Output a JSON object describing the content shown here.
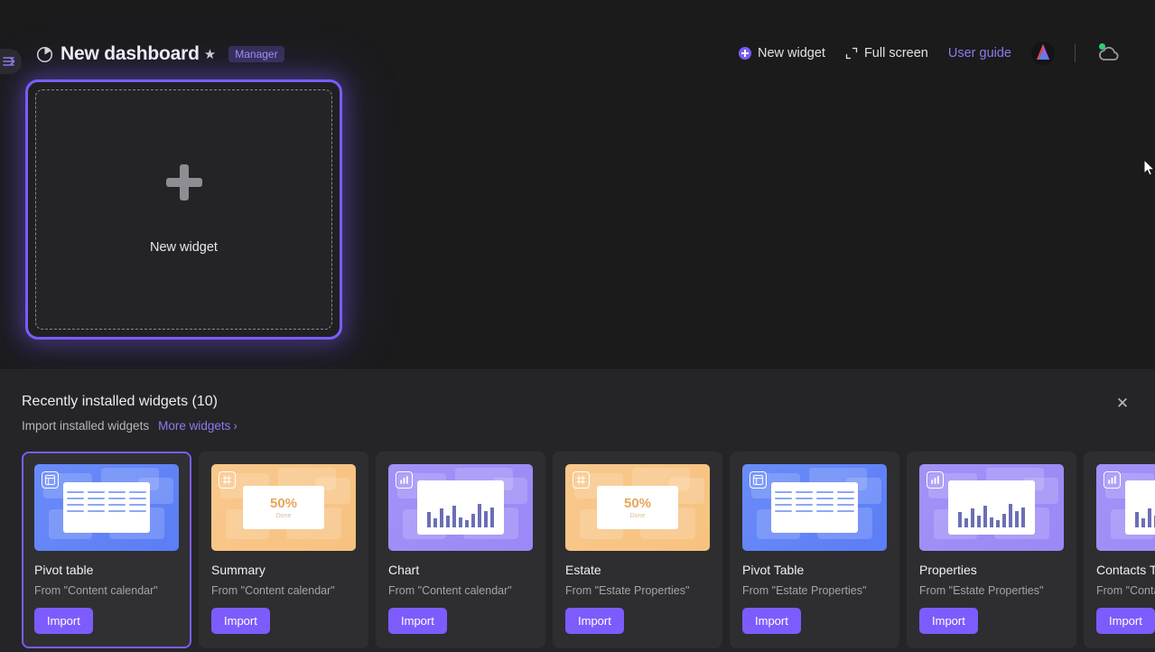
{
  "header": {
    "sidebar_toggle_icon": "sidebar-expand-icon",
    "dashboard_icon": "pie-chart-icon",
    "title": "New dashboard",
    "star_icon": "★",
    "role_badge": "Manager",
    "actions": [
      {
        "label": "New widget",
        "icon": "plus-circle-icon"
      },
      {
        "label": "Full screen",
        "icon": "fullscreen-icon"
      },
      {
        "label": "User guide",
        "icon": "none"
      }
    ],
    "logo_icon": "app-logo-icon",
    "cloud_icon": "cloud-sync-icon",
    "cloud_status_color": "#2fcf72"
  },
  "dropzone": {
    "plus_icon": "plus-icon",
    "label": "New widget"
  },
  "panel": {
    "title": "Recently installed widgets (10)",
    "subtitle": "Import installed widgets",
    "more_link": "More widgets",
    "more_chevron": "›",
    "close_icon": "✕",
    "import_label": "Import",
    "cards": [
      {
        "title": "Pivot table",
        "source": "From \"Content calendar\"",
        "thumb": "blue",
        "art": "table",
        "badge": "pivot-table-icon",
        "selected": true
      },
      {
        "title": "Summary",
        "source": "From \"Content calendar\"",
        "thumb": "orange",
        "art": "pct",
        "badge": "number-icon",
        "selected": false
      },
      {
        "title": "Chart",
        "source": "From \"Content calendar\"",
        "thumb": "purple",
        "art": "chart",
        "badge": "bar-chart-icon",
        "selected": false
      },
      {
        "title": "Estate",
        "source": "From \"Estate Properties\"",
        "thumb": "orange",
        "art": "pct",
        "badge": "number-icon",
        "selected": false
      },
      {
        "title": "Pivot Table",
        "source": "From \"Estate Properties\"",
        "thumb": "blue",
        "art": "table",
        "badge": "pivot-table-icon",
        "selected": false
      },
      {
        "title": "Properties",
        "source": "From \"Estate Properties\"",
        "thumb": "purple",
        "art": "chart",
        "badge": "bar-chart-icon",
        "selected": false
      },
      {
        "title": "Contacts Type",
        "source": "From \"Contacts\"",
        "thumb": "purple",
        "art": "chart",
        "badge": "bar-chart-icon",
        "selected": false
      }
    ],
    "percent_value": "50%",
    "percent_caption": "Done"
  },
  "colors": {
    "accent": "#7c5cfc",
    "link": "#8b7bf0",
    "canvas_bg": "#1b1b1c",
    "panel_bg": "#252527",
    "card_bg": "#2e2e30"
  }
}
